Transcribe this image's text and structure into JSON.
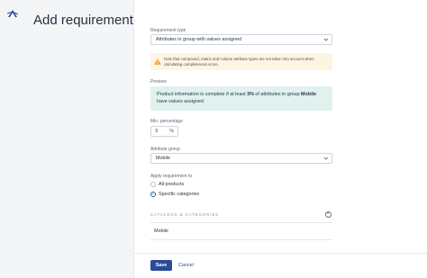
{
  "header": {
    "title": "Add requirement"
  },
  "requirement_type": {
    "label": "Requirement type",
    "value": "Attributes in group with values assigned"
  },
  "warning": {
    "text": "Note that compound, matrix and column attribute types are not taken into account when calculating completeness score."
  },
  "preview": {
    "label": "Preview",
    "text_before": "Product information is complete if at least",
    "percentage": "3%",
    "text_middle": "of attributes in group",
    "group": "Mobile",
    "text_after": "have values assigned"
  },
  "min_percentage": {
    "label": "Min. percentage",
    "value": "3",
    "unit": "%"
  },
  "attribute_group": {
    "label": "Attribute group",
    "value": "Mobile"
  },
  "apply_to": {
    "label": "Apply requirement to",
    "options": [
      {
        "label": "All products",
        "checked": false
      },
      {
        "label": "Specific categories",
        "checked": true
      }
    ]
  },
  "categories": {
    "header": "CATALOGS & CATEGORIES",
    "items": [
      "Mobile"
    ]
  },
  "footer": {
    "save_label": "Save",
    "cancel_label": "Cancel"
  },
  "colors": {
    "primary": "#2b4a9a",
    "warning_bg": "#fdf5e2",
    "preview_bg": "#dff2ee",
    "warning_icon": "#f0a030"
  }
}
